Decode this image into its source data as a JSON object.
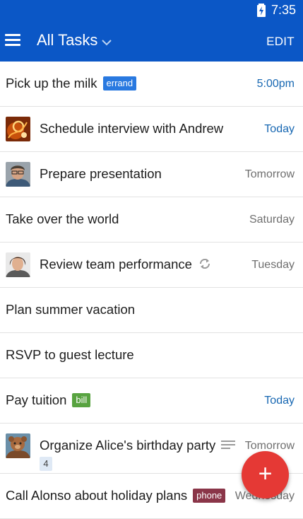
{
  "status_bar": {
    "time": "7:35",
    "battery_icon": "battery-charging-icon"
  },
  "app_bar": {
    "title": "All Tasks",
    "edit_label": "EDIT",
    "menu_icon": "menu-icon",
    "dropdown_icon": "chevron-down-icon"
  },
  "colors": {
    "primary": "#0b57c6",
    "fab": "#e53935",
    "date_blue": "#1767b2",
    "errand_tag": "#2979e0",
    "bill_tag": "#58a340",
    "phone_tag": "#8a3548"
  },
  "tasks": [
    {
      "title": "Pick up the milk",
      "tag": "errand",
      "due": "5:00pm"
    },
    {
      "title": "Schedule interview with Andrew",
      "due": "Today"
    },
    {
      "title": "Prepare presentation",
      "due": "Tomorrow"
    },
    {
      "title": "Take over the world",
      "due": "Saturday"
    },
    {
      "title": "Review team performance",
      "due": "Tuesday",
      "icon": "repeat-icon"
    },
    {
      "title": "Plan summer vacation"
    },
    {
      "title": "RSVP to guest lecture"
    },
    {
      "title": "Pay tuition",
      "tag": "bill",
      "due": "Today"
    },
    {
      "title": "Organize Alice's birthday party",
      "due": "Tomorrow",
      "subtask_count": "4",
      "icon": "notes-icon"
    },
    {
      "title": "Call Alonso about holiday plans",
      "tag": "phone",
      "due": "Wednesday"
    }
  ],
  "fab": {
    "label": "+",
    "icon": "add-icon"
  }
}
